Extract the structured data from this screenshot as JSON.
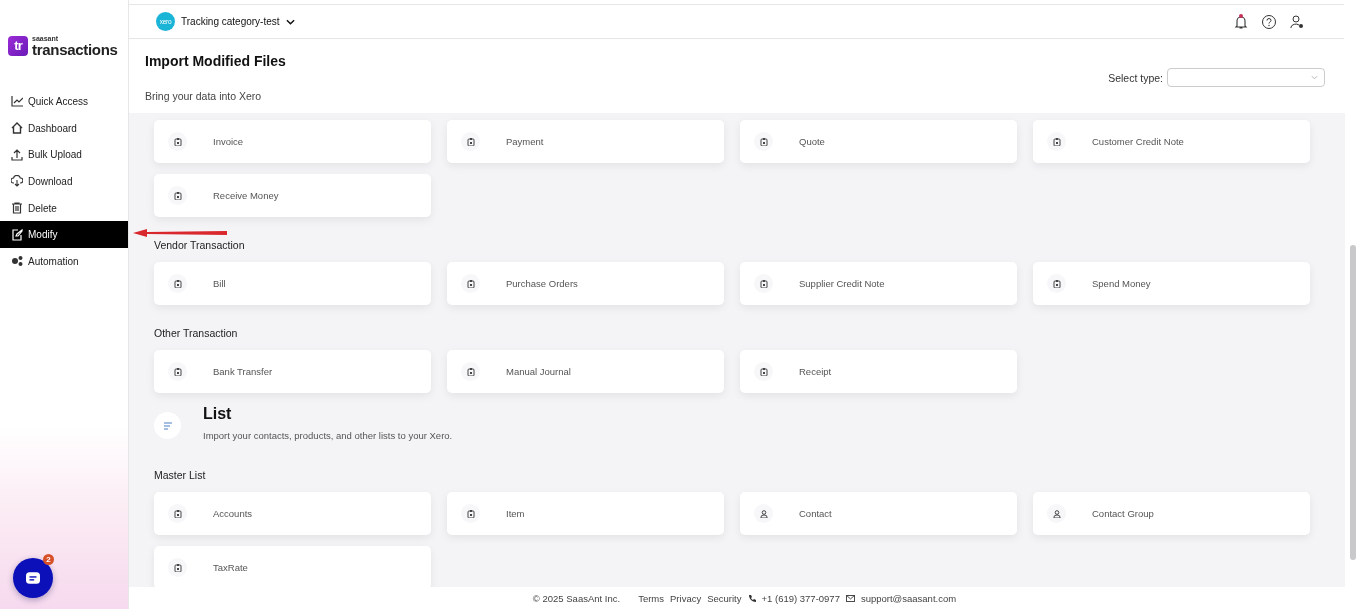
{
  "sidebar": {
    "logo": {
      "mark": "tr",
      "brand": "saasant",
      "product": "transactions"
    },
    "items": [
      {
        "label": "Quick Access",
        "kind": "chart",
        "selected": false
      },
      {
        "label": "Dashboard",
        "kind": "home",
        "selected": false
      },
      {
        "label": "Bulk Upload",
        "kind": "upload",
        "selected": false
      },
      {
        "label": "Download",
        "kind": "cloud",
        "selected": false
      },
      {
        "label": "Delete",
        "kind": "trash",
        "selected": false
      },
      {
        "label": "Modify",
        "kind": "edit",
        "selected": true
      },
      {
        "label": "Automation",
        "kind": "gears",
        "selected": false
      }
    ],
    "chat": {
      "badge": "2"
    }
  },
  "header": {
    "org": {
      "logo": "xero",
      "name": "Tracking category-test"
    }
  },
  "page": {
    "title": "Import Modified Files",
    "subtitle": "Bring your data into Xero",
    "select_type": {
      "label": "Select type:"
    }
  },
  "blocks": [
    {
      "kind": "cards",
      "cards": [
        {
          "label": "Invoice",
          "kind": "document"
        },
        {
          "label": "Payment",
          "kind": "document"
        },
        {
          "label": "Quote",
          "kind": "document"
        },
        {
          "label": "Customer Credit Note",
          "kind": "document"
        },
        {
          "label": "Receive Money",
          "kind": "document"
        }
      ]
    },
    {
      "kind": "heading",
      "text": "Vendor Transaction"
    },
    {
      "kind": "cards",
      "cards": [
        {
          "label": "Bill",
          "kind": "document"
        },
        {
          "label": "Purchase Orders",
          "kind": "document"
        },
        {
          "label": "Supplier Credit Note",
          "kind": "document"
        },
        {
          "label": "Spend Money",
          "kind": "document"
        }
      ]
    },
    {
      "kind": "heading",
      "text": "Other Transaction"
    },
    {
      "kind": "cards",
      "cards": [
        {
          "label": "Bank Transfer",
          "kind": "document"
        },
        {
          "label": "Manual Journal",
          "kind": "document"
        },
        {
          "label": "Receipt",
          "kind": "document"
        }
      ]
    },
    {
      "kind": "intro",
      "title": "List",
      "description": "Import your contacts, products, and other lists to your Xero."
    },
    {
      "kind": "heading",
      "text": "Master List"
    },
    {
      "kind": "cards",
      "cards": [
        {
          "label": "Accounts",
          "kind": "document"
        },
        {
          "label": "Item",
          "kind": "document"
        },
        {
          "label": "Contact",
          "kind": "person"
        },
        {
          "label": "Contact Group",
          "kind": "person"
        },
        {
          "label": "TaxRate",
          "kind": "document"
        }
      ]
    }
  ],
  "footer": {
    "copyright": "© 2025 SaasAnt Inc.",
    "links": [
      "Terms",
      "Privacy",
      "Security"
    ],
    "phone": "+1 (619) 377-0977",
    "email": "support@saasant.com"
  }
}
